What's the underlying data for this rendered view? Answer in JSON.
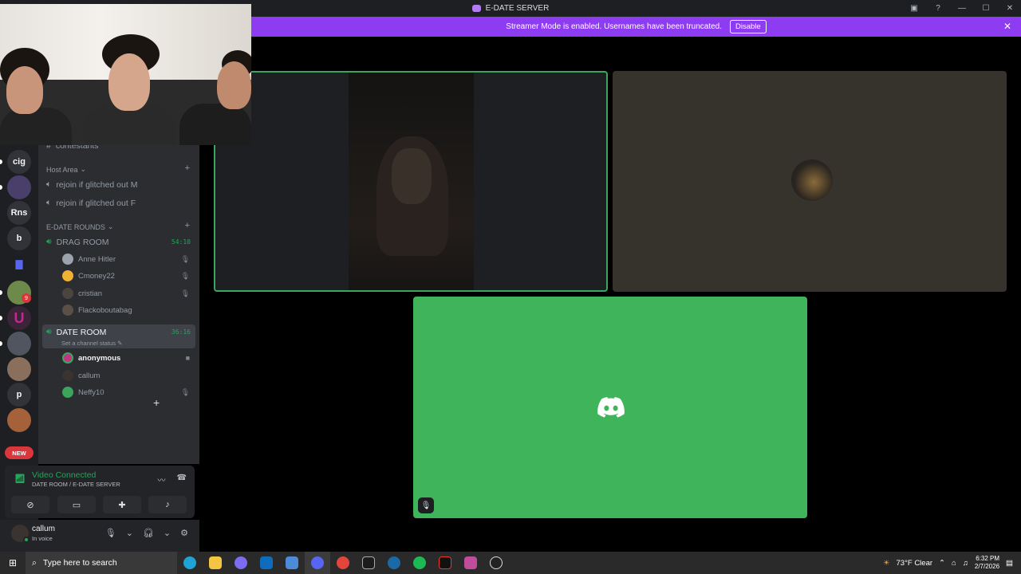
{
  "window": {
    "title": "E-DATE SERVER",
    "window_buttons": [
      "—",
      "☐",
      "✕"
    ]
  },
  "banner": {
    "text": "Streamer Mode is enabled. Usernames have been truncated.",
    "button": "Disable",
    "close": "✕"
  },
  "rail": {
    "items": [
      "cig",
      "Rns",
      "b",
      "p"
    ],
    "new_badge": "NEW",
    "mention_count": "9"
  },
  "sidebar": {
    "partial_channel": "contestants",
    "host_area": {
      "label": "Host Area",
      "channels": [
        "rejoin if glitched out M",
        "rejoin if glitched out F"
      ]
    },
    "edate_rounds": {
      "label": "E-DATE ROUNDS",
      "drag_room": {
        "name": "DRAG ROOM",
        "timer": "54:10",
        "members": [
          "Anne Hitler",
          "Cmoney22",
          "cristian",
          "Flackoboutabag"
        ]
      },
      "date_room": {
        "name": "DATE ROOM",
        "timer": "36:16",
        "status": "Set a channel status",
        "members": [
          "anonymous",
          "callum",
          "Neffy10"
        ]
      }
    }
  },
  "voice": {
    "title": "Video Connected",
    "subtitle": "DATE ROOM / E-DATE SERVER"
  },
  "user": {
    "name": "callum",
    "status": "In voice"
  },
  "taskbar": {
    "search_placeholder": "Type here to search",
    "weather": "73°F  Clear",
    "time": "6:32 PM",
    "date": "2/7/2026"
  },
  "colors": {
    "accent": "#8e3cf2",
    "speaking": "#3ba55c",
    "tile_bg": "#3fb45a",
    "online": "#23a55a"
  }
}
